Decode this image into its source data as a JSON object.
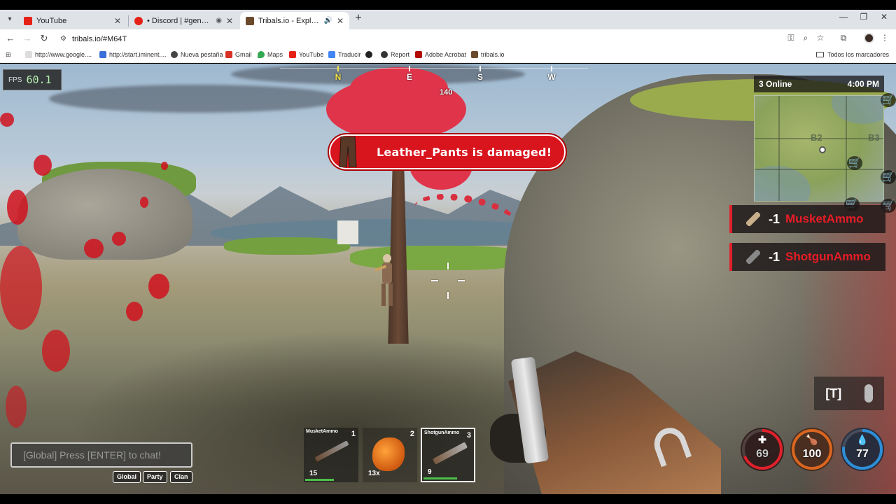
{
  "browser": {
    "tabs": [
      {
        "title": "YouTube",
        "favicon_color": "#e62117",
        "active": false
      },
      {
        "title": "• Discord | #general | • •",
        "favicon_color": "#e62117",
        "active": false
      },
      {
        "title": "Tribals.io - Explore, start cla",
        "favicon_color": "#6a4a2a",
        "active": true
      }
    ],
    "url": "tribals.io/#M64T",
    "bookmarks": [
      {
        "label": "http://www.google....",
        "color": "#888"
      },
      {
        "label": "http://start.iminent....",
        "color": "#3b6fd9"
      },
      {
        "label": "Nueva pestaña",
        "color": "#444"
      },
      {
        "label": "Gmail",
        "color": "#d93025"
      },
      {
        "label": "Maps",
        "color": "#34a853"
      },
      {
        "label": "YouTube",
        "color": "#e62117"
      },
      {
        "label": "Traducir",
        "color": "#4285f4"
      },
      {
        "label": "Report",
        "color": "#333"
      },
      {
        "label": "Adobe Acrobat",
        "color": "#b30b00"
      },
      {
        "label": "tribals.io",
        "color": "#6a4a2a"
      }
    ],
    "all_bookmarks_label": "Todos los marcadores"
  },
  "hud": {
    "fps_label": "FPS",
    "fps_value": "60.1",
    "compass": {
      "labels": [
        "N",
        "E",
        "S",
        "W"
      ],
      "heading": "140"
    },
    "damage_message": "Leather_Pants is damaged!",
    "online": "3 Online",
    "time": "4:00 PM",
    "minimap_labels": [
      "B2",
      "B3"
    ],
    "loot": [
      {
        "qty": "-1",
        "name": "MusketAmmo"
      },
      {
        "qty": "-1",
        "name": "ShotgunAmmo"
      }
    ],
    "talk_key": "[T]",
    "chat_placeholder": "[Global] Press [ENTER] to chat!",
    "chat_tabs": [
      "Global",
      "Party",
      "Clan"
    ],
    "hotbar": [
      {
        "name": "MusketAmmo",
        "slot": "1",
        "count": "15",
        "bar_fraction": 0.55,
        "selected": false
      },
      {
        "name": "",
        "slot": "2",
        "count": "13x",
        "bar_fraction": 0,
        "selected": false
      },
      {
        "name": "ShotgunAmmo",
        "slot": "3",
        "count": "9",
        "bar_fraction": 0.65,
        "selected": true
      }
    ],
    "stats": [
      {
        "name": "health",
        "value": "69",
        "fraction": 0.69,
        "color": "#e0202a"
      },
      {
        "name": "hunger",
        "value": "100",
        "fraction": 1.0,
        "color": "#d9651e"
      },
      {
        "name": "thirst",
        "value": "77",
        "fraction": 0.77,
        "color": "#2e8fd8"
      }
    ],
    "colors": {
      "damage_red": "#d8141d",
      "loot_red": "#e81c26",
      "selected_border": "#ffffff"
    }
  }
}
